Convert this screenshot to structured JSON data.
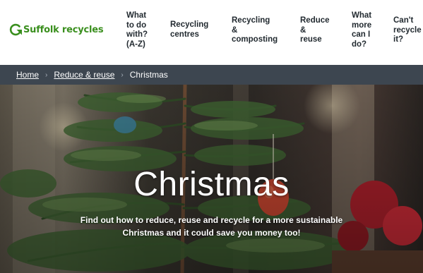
{
  "brand": {
    "logo_text": "Suffolk recycles",
    "accent": "#3a8f1e"
  },
  "nav": {
    "items": [
      {
        "lines": [
          "What",
          "to do",
          "with?",
          "(A-Z)"
        ]
      },
      {
        "lines": [
          "Recycling",
          "centres"
        ]
      },
      {
        "lines": [
          "Recycling",
          "&",
          "composting"
        ]
      },
      {
        "lines": [
          "Reduce",
          "&",
          "reuse"
        ]
      },
      {
        "lines": [
          "What",
          "more",
          "can I",
          "do?"
        ]
      },
      {
        "lines": [
          "Can't",
          "recycle",
          "it?"
        ]
      }
    ]
  },
  "breadcrumb": {
    "home": "Home",
    "section": "Reduce & reuse",
    "current": "Christmas",
    "separator": "›"
  },
  "hero": {
    "title": "Christmas",
    "subtitle_lines": [
      "Find out how to reduce, reuse and recycle for a more sustainable",
      "Christmas and it could save you money too!"
    ]
  }
}
